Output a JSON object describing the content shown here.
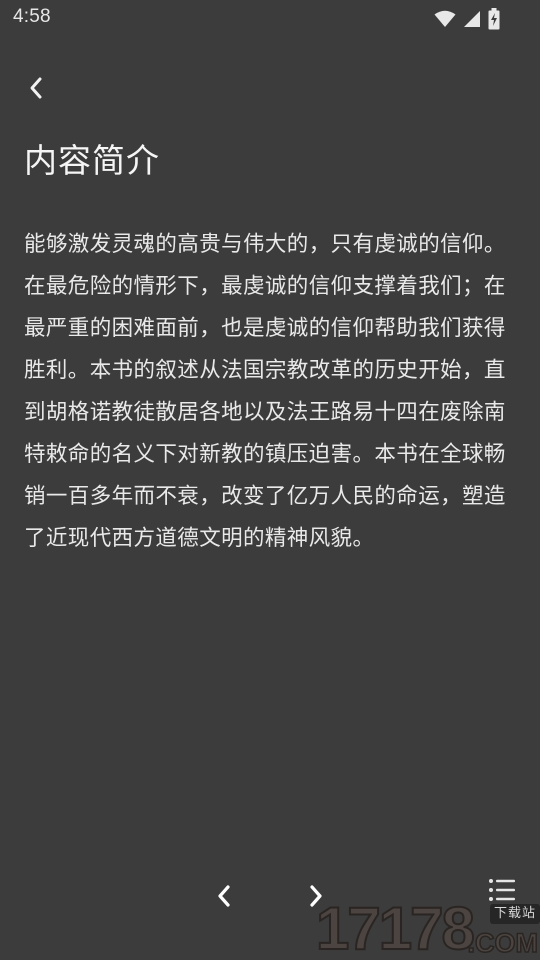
{
  "status_bar": {
    "time": "4:58",
    "icons": [
      "wifi-icon",
      "cellular-signal-icon",
      "battery-charging-icon"
    ]
  },
  "header": {
    "back_icon": "chevron-left-icon",
    "title": "内容简介"
  },
  "content": {
    "intro": "能够激发灵魂的高贵与伟大的，只有虔诚的信仰。在最危险的情形下，最虔诚的信仰支撑着我们；在最严重的困难面前，也是虔诚的信仰帮助我们获得胜利。本书的叙述从法国宗教改革的历史开始，直到胡格诺教徒散居各地以及法王路易十四在废除南特敕命的名义下对新教的镇压迫害。本书在全球畅销一百多年而不衰，改变了亿万人民的命运，塑造了近现代西方道德文明的精神风貌。"
  },
  "bottom_nav": {
    "prev_icon": "chevron-left-icon",
    "next_icon": "chevron-right-icon",
    "toc_icon": "list-icon"
  },
  "watermark": {
    "digits": "17178",
    "tag": "下载站",
    "domain": ".COM"
  },
  "colors": {
    "background": "#3c3c3c",
    "text": "#e9e9e9",
    "icon": "#f0f0f0"
  }
}
